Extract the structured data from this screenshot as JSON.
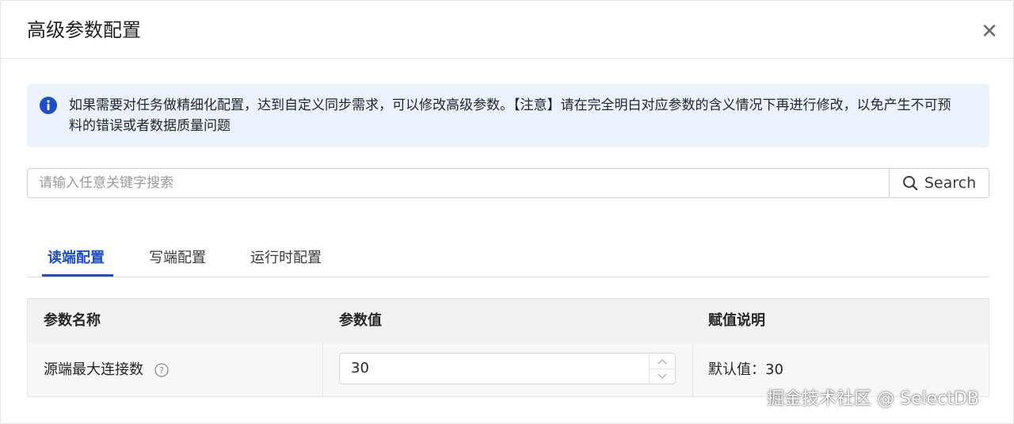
{
  "dialog": {
    "title": "高级参数配置",
    "close_icon": "close-icon"
  },
  "alert": {
    "icon": "info-icon",
    "text": "如果需要对任务做精细化配置，达到自定义同步需求，可以修改高级参数。【注意】请在完全明白对应参数的含义情况下再进行修改，以免产生不可预料的错误或者数据质量问题"
  },
  "search": {
    "placeholder": "请输入任意关键字搜索",
    "value": "",
    "button_label": "Search",
    "button_icon": "search-icon"
  },
  "tabs": [
    {
      "label": "读端配置",
      "active": true
    },
    {
      "label": "写端配置",
      "active": false
    },
    {
      "label": "运行时配置",
      "active": false
    }
  ],
  "table": {
    "headers": [
      "参数名称",
      "参数值",
      "赋值说明"
    ],
    "rows": [
      {
        "name": "源端最大连接数",
        "help_icon": "question-circle-icon",
        "value": "30",
        "description": "默认值：30"
      }
    ]
  },
  "watermark": "掘金技术社区 @ SelectDB",
  "colors": {
    "accent": "#1e4fc4",
    "alert_bg": "#ecf2fd",
    "table_header_bg": "#f2f2f2"
  }
}
